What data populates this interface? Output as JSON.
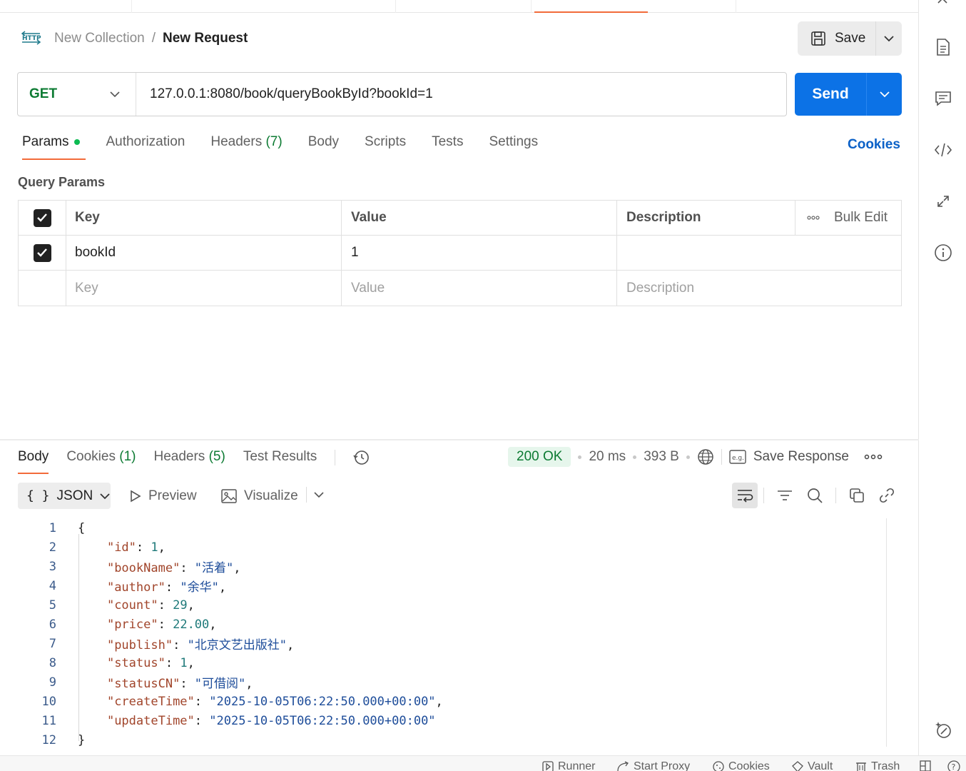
{
  "breadcrumb": {
    "collection": "New Collection",
    "separator": "/",
    "request": "New Request"
  },
  "toolbar": {
    "save_label": "Save",
    "send_label": "Send"
  },
  "request": {
    "method": "GET",
    "url": "127.0.0.1:8080/book/queryBookById?bookId=1"
  },
  "request_tabs": {
    "params": "Params",
    "authorization": "Authorization",
    "headers": "Headers",
    "headers_count": "(7)",
    "body": "Body",
    "scripts": "Scripts",
    "tests": "Tests",
    "settings": "Settings",
    "cookies": "Cookies"
  },
  "query_params": {
    "title": "Query Params",
    "headers": {
      "key": "Key",
      "value": "Value",
      "description": "Description",
      "bulk_edit": "Bulk Edit"
    },
    "rows": [
      {
        "checked": true,
        "key": "bookId",
        "value": "1",
        "description": ""
      }
    ],
    "placeholder": {
      "key": "Key",
      "value": "Value",
      "description": "Description"
    }
  },
  "response_tabs": {
    "body": "Body",
    "cookies": "Cookies",
    "cookies_count": "(1)",
    "headers": "Headers",
    "headers_count": "(5)",
    "test_results": "Test Results"
  },
  "response_meta": {
    "status": "200 OK",
    "time": "20 ms",
    "size": "393 B",
    "save_response": "Save Response"
  },
  "format": {
    "selected": "JSON",
    "preview": "Preview",
    "visualize": "Visualize"
  },
  "code_lines": [
    "{",
    "    \"id\": 1,",
    "    \"bookName\": \"活着\",",
    "    \"author\": \"余华\",",
    "    \"count\": 29,",
    "    \"price\": 22.00,",
    "    \"publish\": \"北京文艺出版社\",",
    "    \"status\": 1,",
    "    \"statusCN\": \"可借阅\",",
    "    \"createTime\": \"2025-10-05T06:22:50.000+00:00\",",
    "    \"updateTime\": \"2025-10-05T06:22:50.000+00:00\"",
    "}"
  ],
  "footer": {
    "runner": "Runner",
    "start_proxy": "Start Proxy",
    "cookies": "Cookies",
    "vault": "Vault",
    "trash": "Trash"
  },
  "colors": {
    "accent": "#f26b3a",
    "send": "#0c72e6",
    "method_get": "#0d7b33",
    "status_ok_bg": "#e6f6ec"
  }
}
